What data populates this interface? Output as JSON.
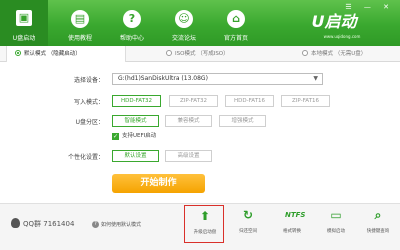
{
  "nav": [
    {
      "label": "U盘启动",
      "icon": "usb-icon"
    },
    {
      "label": "使用教程",
      "icon": "book-icon"
    },
    {
      "label": "帮助中心",
      "icon": "help-icon"
    },
    {
      "label": "交流论坛",
      "icon": "forum-icon"
    },
    {
      "label": "官方首页",
      "icon": "home-icon"
    }
  ],
  "logo": {
    "text": "U启动",
    "url": "www.uqidong.com"
  },
  "window_controls": "☰ — ✕",
  "tabs": [
    {
      "label": "默认模式  （隐藏启动）",
      "active": true
    },
    {
      "label": "ISO模式  （写成ISO）",
      "active": false
    },
    {
      "label": "本地模式  （无需U盘）",
      "active": false
    }
  ],
  "form": {
    "device_label": "选择设备：",
    "device_value": "G:(hd1)SanDiskUltra (13.08G)",
    "write_label": "写入模式：",
    "write_modes": [
      "HDD-FAT32",
      "ZIP-FAT32",
      "HDD-FAT16",
      "ZIP-FAT16"
    ],
    "partition_label": "U盘分区：",
    "partition_modes": [
      "智能模式",
      "兼容模式",
      "增强模式"
    ],
    "uefi_label": "支持UEFI启动",
    "personalize_label": "个性化设置：",
    "personalize_buttons": [
      "默认设置",
      "高级设置"
    ]
  },
  "start_button": "开始制作",
  "bottom": {
    "qq_text": "QQ群 7161404",
    "help_text": "如何使用默认模式"
  },
  "tools": [
    {
      "label": "升级启动盘",
      "icon": "upgrade-icon"
    },
    {
      "label": "归还空间",
      "icon": "restore-icon"
    },
    {
      "label": "格式转换",
      "icon": "ntfs-icon"
    },
    {
      "label": "模拟启动",
      "icon": "simulate-icon"
    },
    {
      "label": "快捷键查询",
      "icon": "search-icon"
    }
  ],
  "colors": {
    "brand_green": "#3aa82f",
    "accent_orange": "#f5a300",
    "highlight_red": "#d9302a"
  }
}
